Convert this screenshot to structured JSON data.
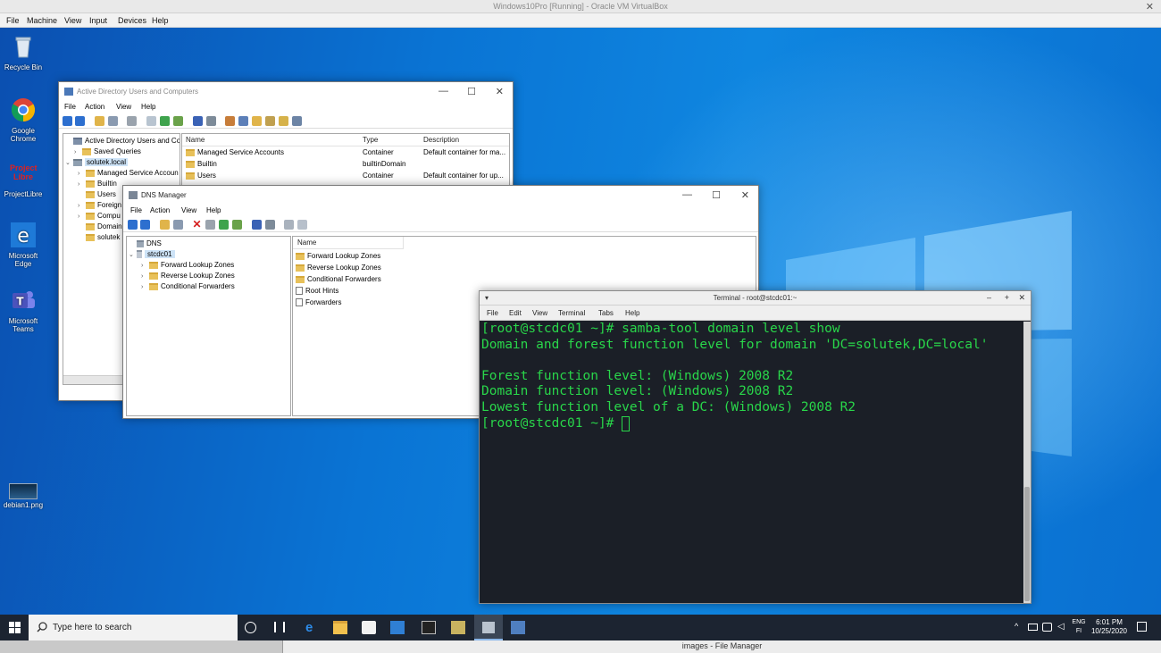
{
  "vbox": {
    "title": "Windows10Pro [Running] - Oracle VM VirtualBox",
    "menu": [
      "File",
      "Machine",
      "View",
      "Input",
      "Devices",
      "Help"
    ]
  },
  "desktop_icons": [
    {
      "label": "Recycle Bin",
      "icon": "recycle-bin-icon"
    },
    {
      "label": "Google Chrome",
      "icon": "chrome-icon"
    },
    {
      "label": "ProjectLibre",
      "icon": "projectlibre-icon",
      "logo_text": "Project Libre"
    },
    {
      "label": "Microsoft Edge",
      "icon": "edge-icon"
    },
    {
      "label": "Microsoft Teams",
      "icon": "teams-icon"
    },
    {
      "label": "debian1.png",
      "icon": "image-file-icon"
    }
  ],
  "aduc": {
    "title": "Active Directory Users and Computers",
    "menu": [
      "File",
      "Action",
      "View",
      "Help"
    ],
    "tree": [
      {
        "label": "Active Directory Users and Com",
        "indent": 0,
        "arrow": ""
      },
      {
        "label": "Saved Queries",
        "indent": 1,
        "arrow": "›"
      },
      {
        "label": "solutek.local",
        "indent": 1,
        "arrow": "⌄"
      },
      {
        "label": "Managed Service Accoun",
        "indent": 2,
        "arrow": "›"
      },
      {
        "label": "Builtin",
        "indent": 2,
        "arrow": "›"
      },
      {
        "label": "Users",
        "indent": 2,
        "arrow": ""
      },
      {
        "label": "Foreign",
        "indent": 2,
        "arrow": "›"
      },
      {
        "label": "Compu",
        "indent": 2,
        "arrow": "›"
      },
      {
        "label": "Domain",
        "indent": 2,
        "arrow": ""
      },
      {
        "label": "solutek",
        "indent": 2,
        "arrow": ""
      }
    ],
    "columns": [
      "Name",
      "Type",
      "Description"
    ],
    "rows": [
      {
        "name": "Managed Service Accounts",
        "type": "Container",
        "description": "Default container for ma..."
      },
      {
        "name": "Builtin",
        "type": "builtinDomain",
        "description": ""
      },
      {
        "name": "Users",
        "type": "Container",
        "description": "Default container for up..."
      }
    ]
  },
  "dns": {
    "title": "DNS Manager",
    "menu": [
      "File",
      "Action",
      "View",
      "Help"
    ],
    "tree": [
      {
        "label": "DNS",
        "indent": 0,
        "arrow": ""
      },
      {
        "label": "stcdc01",
        "indent": 1,
        "arrow": "⌄"
      },
      {
        "label": "Forward Lookup Zones",
        "indent": 2,
        "arrow": "›"
      },
      {
        "label": "Reverse Lookup Zones",
        "indent": 2,
        "arrow": "›"
      },
      {
        "label": "Conditional Forwarders",
        "indent": 2,
        "arrow": "›"
      }
    ],
    "column": "Name",
    "rows": [
      "Forward Lookup Zones",
      "Reverse Lookup Zones",
      "Conditional Forwarders",
      "Root Hints",
      "Forwarders"
    ]
  },
  "terminal": {
    "title": "Terminal - root@stcdc01:~",
    "menu": [
      "File",
      "Edit",
      "View",
      "Terminal",
      "Tabs",
      "Help"
    ],
    "lines": [
      "[root@stcdc01 ~]# samba-tool domain level show",
      "Domain and forest function level for domain 'DC=solutek,DC=local'",
      "",
      "Forest function level: (Windows) 2008 R2",
      "Domain function level: (Windows) 2008 R2",
      "Lowest function level of a DC: (Windows) 2008 R2"
    ],
    "prompt": "[root@stcdc01 ~]# ",
    "text_color": "#29d64a",
    "background": "#1b1f27"
  },
  "taskbar": {
    "search_placeholder": "Type here to search",
    "lang_top": "ENG",
    "lang_bottom": "FI",
    "time": "6:01 PM",
    "date": "10/25/2020"
  },
  "host_file_manager": {
    "title": "images - File Manager"
  },
  "colors": {
    "desktop": "#0a7fd6",
    "taskbar": "#1c2431",
    "folder": "#e8c15a"
  }
}
